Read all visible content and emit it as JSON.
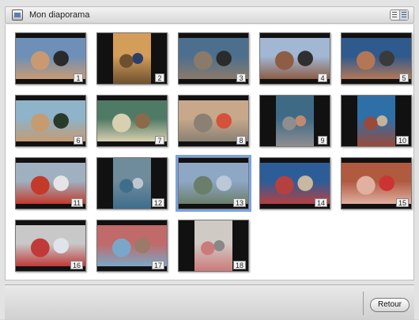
{
  "window": {
    "title": "Mon diaporama"
  },
  "toolbar": {
    "view_toggle_icon": "list-grid-toggle-icon",
    "app_icon": "slideshow-icon"
  },
  "slides": [
    {
      "number": "1",
      "colors": [
        "#6e8fb7",
        "#c99a72",
        "#2a2a2a"
      ]
    },
    {
      "number": "2",
      "colors": [
        "#d39d5a",
        "#6e5030",
        "#2b3f6a"
      ]
    },
    {
      "number": "3",
      "colors": [
        "#4d6f8e",
        "#8a7a6a",
        "#2b2b2b"
      ]
    },
    {
      "number": "4",
      "colors": [
        "#a1b7d4",
        "#8d5d45",
        "#2f2f2f"
      ]
    },
    {
      "number": "5",
      "colors": [
        "#2f5a8d",
        "#b47755",
        "#3a3a3a"
      ]
    },
    {
      "number": "6",
      "colors": [
        "#8fb3c8",
        "#c59b72",
        "#2a3a2a"
      ]
    },
    {
      "number": "7",
      "colors": [
        "#4f7a66",
        "#d8d0b0",
        "#8a6a4a"
      ]
    },
    {
      "number": "8",
      "colors": [
        "#c7a88a",
        "#8a8074",
        "#d5523a"
      ]
    },
    {
      "number": "9",
      "colors": [
        "#3f6a86",
        "#8e8e90",
        "#c08a70"
      ]
    },
    {
      "number": "10",
      "colors": [
        "#2e6fa8",
        "#9a4a3a",
        "#c4b29a"
      ]
    },
    {
      "number": "11",
      "colors": [
        "#9fb0c0",
        "#c43a2a",
        "#e5e5e5"
      ]
    },
    {
      "number": "12",
      "colors": [
        "#6e8c9b",
        "#3f6d8c",
        "#bfc6cf"
      ]
    },
    {
      "number": "13",
      "colors": [
        "#8ea7c4",
        "#6a7f6a",
        "#bbc8d8"
      ]
    },
    {
      "number": "14",
      "colors": [
        "#2d5d99",
        "#b54040",
        "#c9b8a0"
      ]
    },
    {
      "number": "15",
      "colors": [
        "#b05a40",
        "#e0b0a0",
        "#cc3333"
      ]
    },
    {
      "number": "16",
      "colors": [
        "#c8c8c8",
        "#c03a3a",
        "#e0e4ea"
      ]
    },
    {
      "number": "17",
      "colors": [
        "#c06a6a",
        "#7aa7c7",
        "#9a7a6a"
      ]
    },
    {
      "number": "18",
      "colors": [
        "#d0cac4",
        "#cc7a7a",
        "#888888"
      ]
    }
  ],
  "selected_slide": "13",
  "footer": {
    "back_label": "Retour"
  }
}
